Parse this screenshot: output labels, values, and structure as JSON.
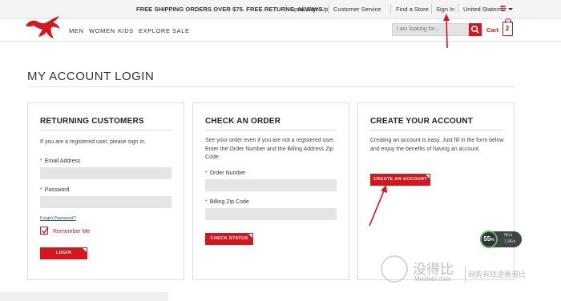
{
  "topbar": {
    "promo": "FREE SHIPPING ORDERS OVER $75. FREE RETURNS, ALWAYS",
    "email_signup": "Email Sign Up",
    "customer_service": "Customer Service",
    "find_store": "Find a Store",
    "sign_in": "Sign In",
    "country": "United States"
  },
  "header": {
    "nav": [
      "MEN",
      "WOMEN",
      "KIDS",
      "EXPLORE",
      "SALE"
    ],
    "search_placeholder": "I am looking for...",
    "cart_label": "Cart",
    "cart_count": "2"
  },
  "page": {
    "title": "MY ACCOUNT LOGIN"
  },
  "returning": {
    "title": "RETURNING CUSTOMERS",
    "intro": "If you are a registered user, please sign in.",
    "email_label": "Email Address",
    "password_label": "Password",
    "forgot": "Forgot Password?",
    "remember": "Remember Me",
    "remember_checked": true,
    "login_button": "LOGIN"
  },
  "check_order": {
    "title": "CHECK AN ORDER",
    "intro": "See your order even if you are not a registered user. Enter the Order Number and the Billing Address Zip Code.",
    "order_label": "Order Number",
    "zip_label": "Billing Zip Code",
    "button": "CHECK STATUS"
  },
  "create": {
    "title": "CREATE YOUR ACCOUNT",
    "intro": "Creating an account is easy. Just fill in the form below and enjoy the benefits of having an account.",
    "button": "CREATE AN ACCOUNT"
  },
  "widget": {
    "percent": "55",
    "percent_unit": "%",
    "up": "0K/s",
    "down": "1.9K/s"
  },
  "watermark": {
    "main": "没得比",
    "domain": "Meidebi.com",
    "sub": "网购有钱途看得比"
  },
  "colors": {
    "brand_red": "#d6161d",
    "topbar_bg": "#f4f4f4",
    "field_bg": "#e5e5e5"
  }
}
